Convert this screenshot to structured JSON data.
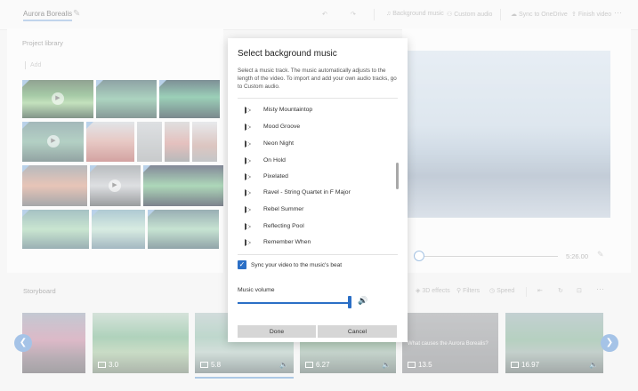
{
  "toolbar": {
    "project_title": "Aurora Borealis",
    "background_music_label": "Background music",
    "custom_audio_label": "Custom audio",
    "sync_onedrive_label": "Sync to OneDrive",
    "finish_video_label": "Finish video",
    "more_label": "···",
    "icons": [
      "pencil-icon",
      "undo-icon",
      "redo-icon",
      "music-note-icon",
      "people-icon",
      "cloud-icon",
      "export-icon"
    ]
  },
  "library": {
    "title": "Project library",
    "add_label": "Add"
  },
  "preview": {
    "total_time": "5:26.00"
  },
  "storyboard": {
    "title": "Storyboard",
    "tools": [
      "3D effects",
      "Filters",
      "Speed"
    ],
    "clips": [
      {
        "duration": "",
        "has_audio": false,
        "caption": ""
      },
      {
        "duration": "3.0",
        "has_audio": false,
        "caption": ""
      },
      {
        "duration": "5.8",
        "has_audio": true,
        "caption": "",
        "selected": true
      },
      {
        "duration": "6.27",
        "has_audio": true,
        "caption": ""
      },
      {
        "duration": "13.5",
        "has_audio": false,
        "caption": "What causes the Aurora Borealis?"
      },
      {
        "duration": "16.97",
        "has_audio": true,
        "caption": ""
      }
    ]
  },
  "dialog": {
    "title": "Select background music",
    "description": "Select a music track. The music automatically adjusts to the length of the video. To import and add your own audio tracks, go to Custom audio.",
    "tracks": [
      "Misty Mountaintop",
      "Mood Groove",
      "Neon Night",
      "On Hold",
      "Pixelated",
      "Ravel - String Quartet in F Major",
      "Rebel Summer",
      "Reflecting Pool",
      "Remember When"
    ],
    "sync_checkbox_label": "Sync your video to the music's beat",
    "sync_checked": true,
    "volume_label": "Music volume",
    "volume_level": 0.98,
    "done_label": "Done",
    "cancel_label": "Cancel"
  },
  "colors": {
    "accent": "#2b6fc6",
    "dim_overlay": "rgba(255,255,255,0.38)"
  }
}
